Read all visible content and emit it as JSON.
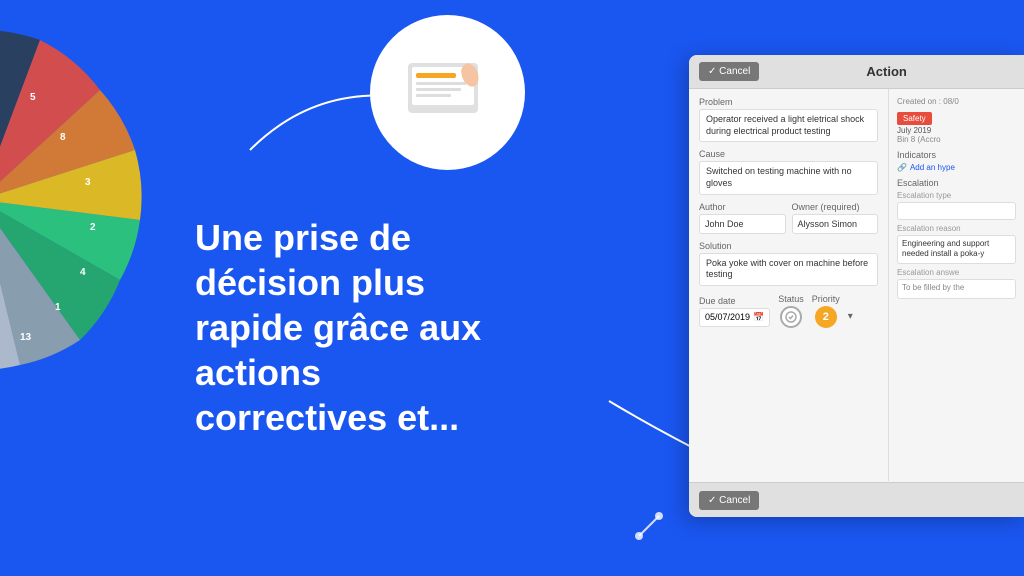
{
  "background_color": "#1a56f0",
  "main_text": {
    "line1": "Une prise de",
    "line2": "décision plus",
    "line3": "rapide grâce aux",
    "line4": "actions",
    "line5": "correctives et..."
  },
  "action_panel": {
    "title": "Action",
    "cancel_label": "✓ Cancel",
    "header_created": "Created on : 08/0",
    "problem_label": "Problem",
    "problem_value": "Operator received a light eletrical shock during electrical product testing",
    "cause_label": "Cause",
    "cause_value": "Switched on testing machine with no gloves",
    "author_label": "Author",
    "author_value": "John Doe",
    "owner_label": "Owner (required)",
    "owner_value": "Alysson Simon",
    "solution_label": "Solution",
    "solution_value": "Poka yoke with cover on machine before testing",
    "due_date_label": "Due date",
    "due_date_value": "05/07/2019",
    "status_label": "Status",
    "priority_label": "Priority",
    "priority_value": "2",
    "right_panel": {
      "safety_label": "Safety",
      "safety_date": "July 2019",
      "safety_bin": "Bin 8 (Accro",
      "indicators_label": "Indicators",
      "add_hyperlink": "Add an hype",
      "escalation_label": "Escalation",
      "escalation_type_label": "Escalation type",
      "escalation_reason_label": "Escalation reason",
      "escalation_reason_text": "Engineering and support needed install a poka-y",
      "escalation_answer_label": "Escalation answe",
      "escalation_answer_text": "To be filled by the"
    }
  }
}
